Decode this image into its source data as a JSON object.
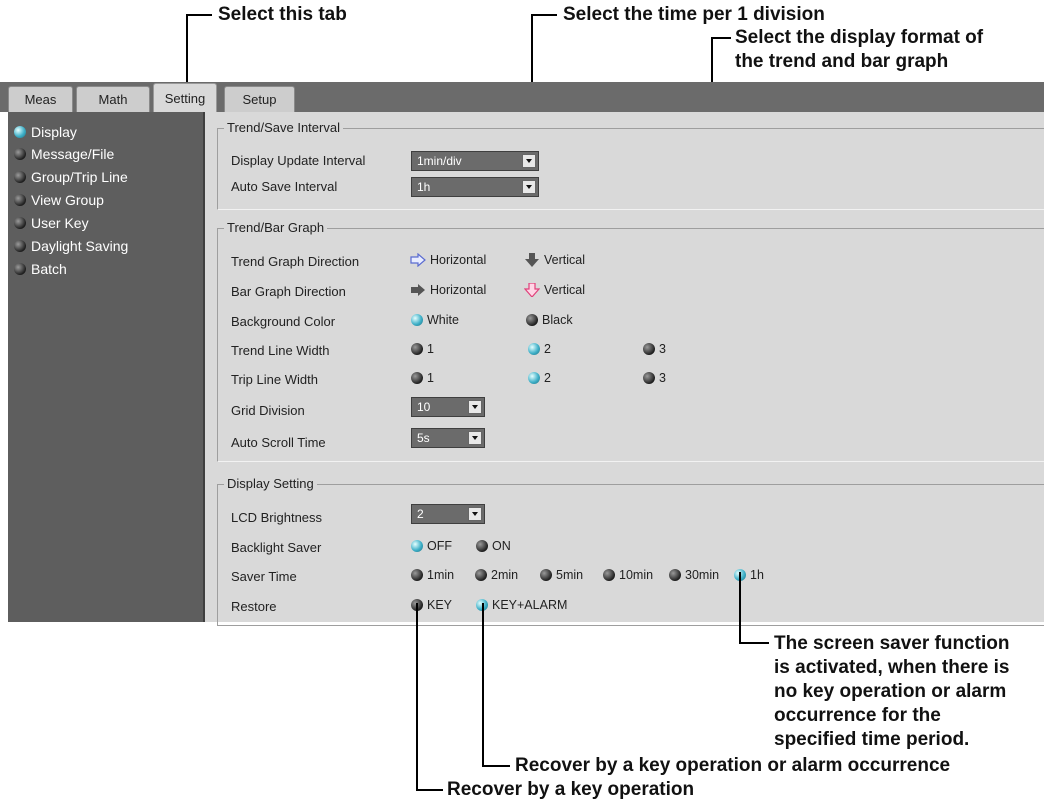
{
  "callouts": {
    "tab": "Select this tab",
    "time_div": "Select the time per 1 division",
    "format_line1": "Select the display format of",
    "format_line2": "the trend and bar graph",
    "saver_line1": "The screen saver function",
    "saver_line2": "is activated, when there is",
    "saver_line3": "no key operation or alarm",
    "saver_line4": "occurrence for the",
    "saver_line5": "specified time period.",
    "key_alarm": "Recover by a key operation or alarm occurrence",
    "key": "Recover by a key operation"
  },
  "tabs": [
    "Meas",
    "Math",
    "Setting",
    "Setup"
  ],
  "sidebar": {
    "items": [
      {
        "label": "Display",
        "active": true
      },
      {
        "label": "Message/File",
        "active": false
      },
      {
        "label": "Group/Trip Line",
        "active": false
      },
      {
        "label": "View Group",
        "active": false
      },
      {
        "label": "User Key",
        "active": false
      },
      {
        "label": "Daylight Saving",
        "active": false
      },
      {
        "label": "Batch",
        "active": false
      }
    ]
  },
  "trend_save": {
    "title": "Trend/Save Interval",
    "display_update_label": "Display Update Interval",
    "display_update_value": "1min/div",
    "auto_save_label": "Auto Save Interval",
    "auto_save_value": "1h"
  },
  "trend_bar": {
    "title": "Trend/Bar Graph",
    "trend_dir_label": "Trend Graph Direction",
    "bar_dir_label": "Bar Graph Direction",
    "horizontal": "Horizontal",
    "vertical": "Vertical",
    "bg_color_label": "Background Color",
    "white": "White",
    "black": "Black",
    "trend_width_label": "Trend Line Width",
    "trip_width_label": "Trip Line Width",
    "w1": "1",
    "w2": "2",
    "w3": "3",
    "grid_label": "Grid Division",
    "grid_value": "10",
    "scroll_label": "Auto Scroll Time",
    "scroll_value": "5s"
  },
  "display_setting": {
    "title": "Display Setting",
    "lcd_label": "LCD Brightness",
    "lcd_value": "2",
    "backlight_label": "Backlight Saver",
    "off": "OFF",
    "on": "ON",
    "saver_time_label": "Saver Time",
    "times": [
      "1min",
      "2min",
      "5min",
      "10min",
      "30min",
      "1h"
    ],
    "restore_label": "Restore",
    "restore_key": "KEY",
    "restore_key_alarm": "KEY+ALARM"
  },
  "colors": {
    "led_on": "#3fb0c8",
    "tabbar": "#6b6b6b",
    "sidebar": "#5e5e5e",
    "panel": "#d9d9d9"
  }
}
